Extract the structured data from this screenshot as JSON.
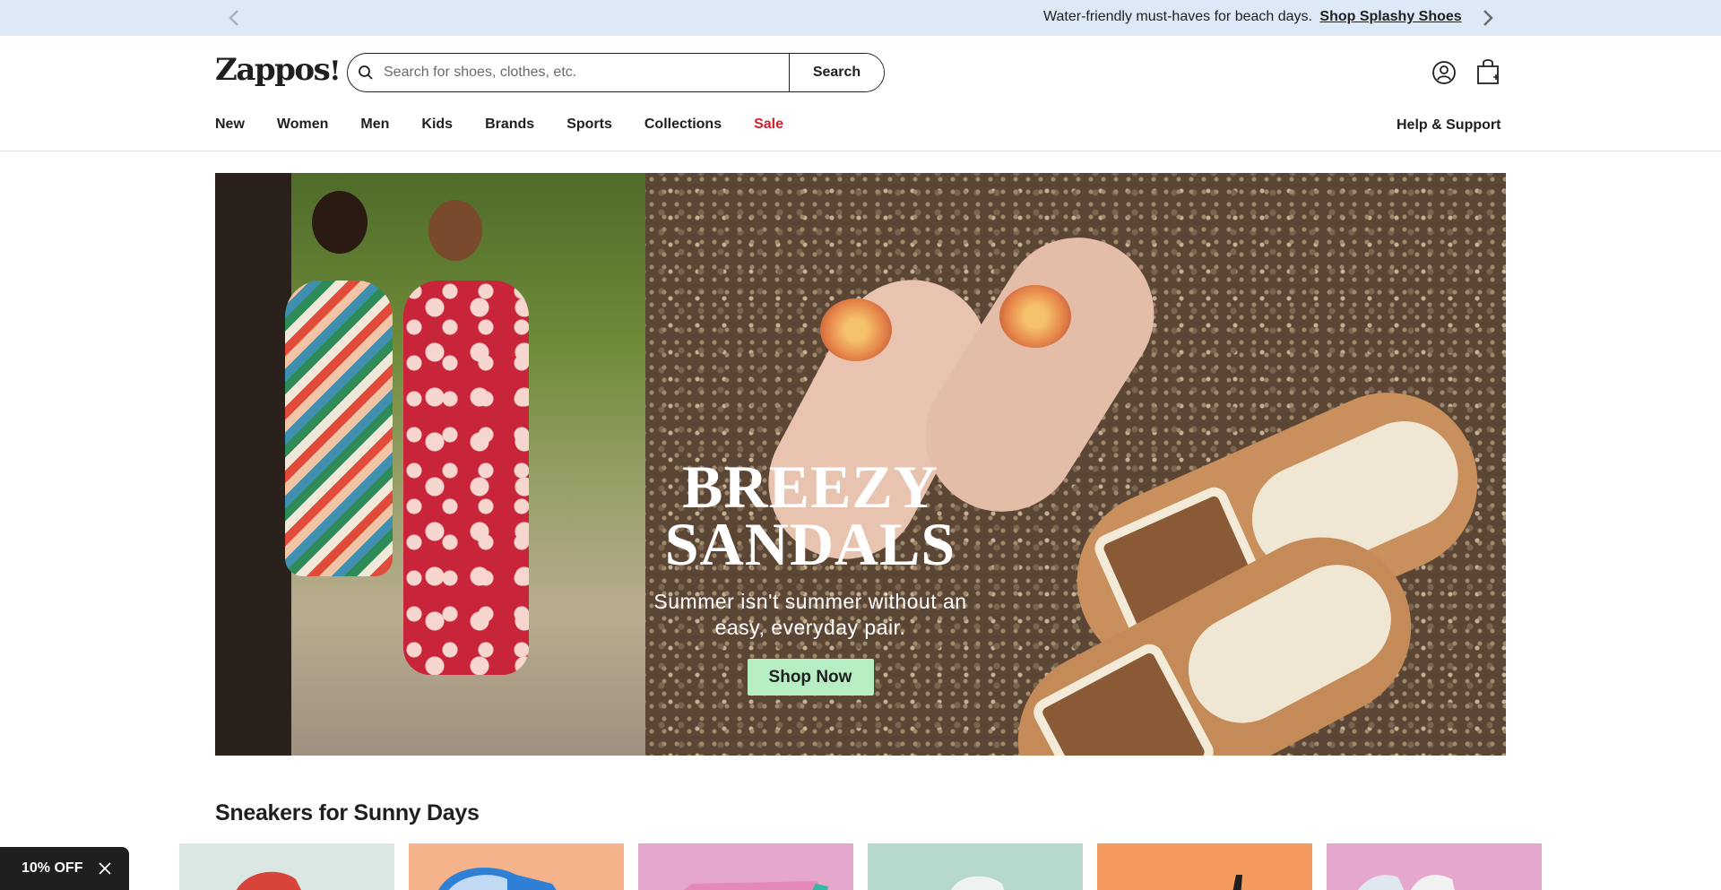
{
  "promo": {
    "message": "Water-friendly must-haves for beach days.",
    "link": "Shop Splashy Shoes"
  },
  "header": {
    "logo": "Zappos",
    "search_placeholder": "Search for shoes, clothes, etc.",
    "search_button": "Search"
  },
  "nav": {
    "items": [
      "New",
      "Women",
      "Men",
      "Kids",
      "Brands",
      "Sports",
      "Collections",
      "Sale"
    ],
    "help": "Help & Support"
  },
  "hero": {
    "title_line1": "BREEZY",
    "title_line2": "SANDALS",
    "subtitle": "Summer isn't summer without an easy, everyday pair.",
    "cta": "Shop Now"
  },
  "section": {
    "title": "Sneakers for Sunny Days",
    "cards": [
      {
        "bg": "#dbe7e2"
      },
      {
        "bg": "#f4b38a"
      },
      {
        "bg": "#e6a7cd"
      },
      {
        "bg": "#b6d8cc"
      },
      {
        "bg": "#f39a5e"
      },
      {
        "bg": "#e6a7cd"
      }
    ]
  },
  "discount_tab": {
    "label": "10% OFF"
  },
  "colors": {
    "promo_bg": "#dde9f7",
    "sale_red": "#d01f2f",
    "cta_green": "#b7eec4"
  }
}
